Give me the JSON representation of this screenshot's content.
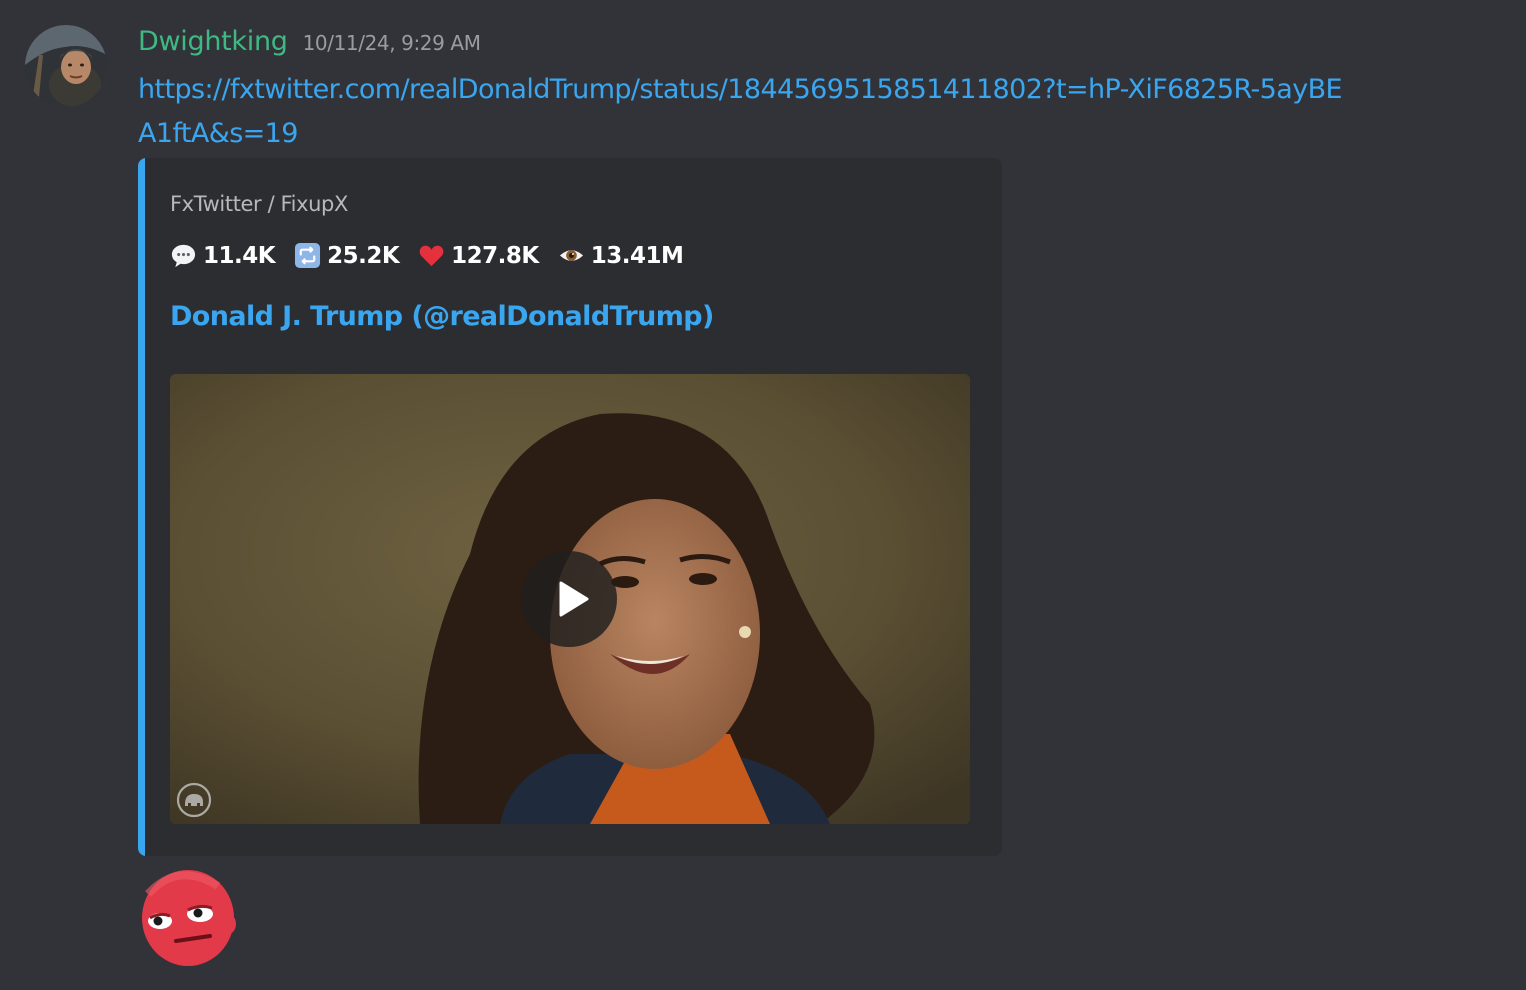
{
  "message": {
    "username": "Dwightking",
    "timestamp": "10/11/24, 9:29 AM",
    "link": "https://fxtwitter.com/realDonaldTrump/status/1844569515851411802?t=hP-XiF6825R-5ayBEA1ftA&s=19",
    "avatar_icon": "user-avatar",
    "sticker_icon": "red-face-sticker"
  },
  "embed": {
    "accent_color": "#3aa6f0",
    "provider": "FxTwitter / FixupX",
    "stats": {
      "replies": "11.4K",
      "retweets": "25.2K",
      "likes": "127.8K",
      "views": "13.41M"
    },
    "author": "Donald J. Trump (@realDonaldTrump)",
    "video": {
      "play_icon": "play-icon",
      "watermark_icon": "gop-elephant-icon"
    }
  },
  "colors": {
    "background": "#313338",
    "embed_background": "#2b2d31",
    "username": "#3fb983",
    "link": "#3aa6f0",
    "timestamp": "#9b9ca3"
  }
}
